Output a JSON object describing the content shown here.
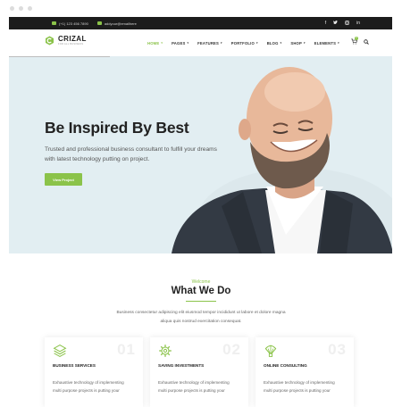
{
  "topbar": {
    "phone": "(+1) 123 456 7890",
    "email": "addyour@emailhere",
    "social_icons": [
      "facebook-icon",
      "twitter-icon",
      "instagram-icon",
      "linkedin-icon"
    ]
  },
  "header": {
    "logo_name": "CRIZAL",
    "logo_tagline": "FOR ALL BUSINESS",
    "nav": [
      {
        "label": "HOME",
        "active": true
      },
      {
        "label": "PAGES",
        "active": false
      },
      {
        "label": "FEATURES",
        "active": false
      },
      {
        "label": "PORTFOLIO",
        "active": false
      },
      {
        "label": "BLOG",
        "active": false
      },
      {
        "label": "SHOP",
        "active": false
      },
      {
        "label": "ELEMENTS",
        "active": false
      }
    ],
    "cart_count": "0"
  },
  "hero": {
    "title": "Be Inspired By Best",
    "text": "Trusted and professional business consultant to fulfill your dreams with latest technology putting on project.",
    "button": "View Project"
  },
  "section": {
    "eyebrow": "Welcome",
    "title": "What We Do",
    "description": "Business consectetur adipiscing elit eiusmod tempor incididunt ut labore et dolore magna aliqua quis nostrud exercitation consequat."
  },
  "cards": [
    {
      "num": "01",
      "title": "BUSINESS SERVICES",
      "text": "Exhaustive technology of implementing multi purpose projects is putting your",
      "icon": "layers-icon"
    },
    {
      "num": "02",
      "title": "SAVING INVESTMENTS",
      "text": "Exhaustive technology of implementing multi purpose projects is putting your",
      "icon": "gear-icon"
    },
    {
      "num": "03",
      "title": "ONLINE CONSULTING",
      "text": "Exhaustive technology of implementing multi purpose projects is putting your",
      "icon": "balloon-icon"
    }
  ],
  "colors": {
    "accent": "#8bc34a",
    "topbar": "#1c1c1c",
    "hero_bg": "#e2eef2"
  }
}
